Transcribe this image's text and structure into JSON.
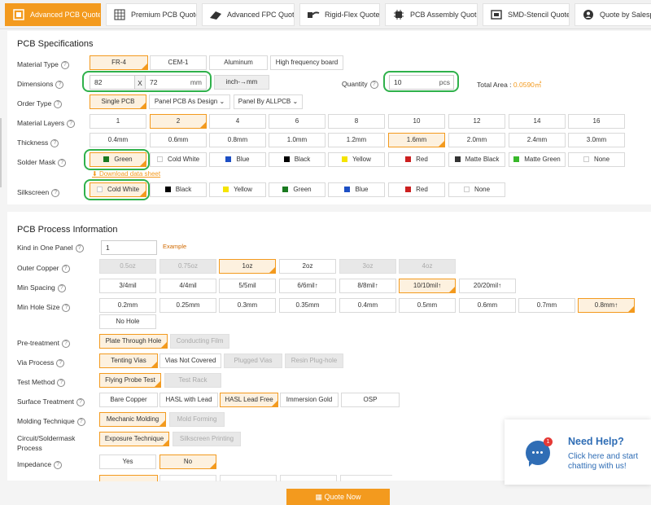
{
  "tabs": [
    "Advanced PCB Quote",
    "Premium PCB Quote",
    "Advanced FPC Quote",
    "Rigid-Flex Quote",
    "PCB Assembly Quote",
    "SMD-Stencil Quote",
    "Quote by Salesperson"
  ],
  "spec": {
    "title": "PCB Specifications",
    "material_type": {
      "label": "Material Type",
      "options": [
        "FR-4",
        "CEM-1",
        "Aluminum",
        "High frequency board"
      ]
    },
    "dimensions": {
      "label": "Dimensions",
      "width": "82",
      "x": "X",
      "height": "72",
      "unit": "mm",
      "convert": "inch-→mm"
    },
    "quantity": {
      "label": "Quantity",
      "value": "10",
      "unit": "pcs"
    },
    "total_area": {
      "label": "Total Area :",
      "value": "0.0590㎡"
    },
    "order_type": {
      "label": "Order Type",
      "options": [
        "Single PCB",
        "Panel PCB As Design",
        "Panel By ALLPCB"
      ]
    },
    "layers": {
      "label": "Material Layers",
      "options": [
        "1",
        "2",
        "4",
        "6",
        "8",
        "10",
        "12",
        "14",
        "16"
      ]
    },
    "thickness": {
      "label": "Thickness",
      "options": [
        "0.4mm",
        "0.6mm",
        "0.8mm",
        "1.0mm",
        "1.2mm",
        "1.6mm",
        "2.0mm",
        "2.4mm",
        "3.0mm"
      ]
    },
    "solder_mask": {
      "label": "Solder Mask",
      "options": [
        "Green",
        "Cold White",
        "Blue",
        "Black",
        "Yellow",
        "Red",
        "Matte Black",
        "Matte Green",
        "None"
      ],
      "download": "Download data sheet"
    },
    "silkscreen": {
      "label": "Silkscreen",
      "options": [
        "Cold White",
        "Black",
        "Yellow",
        "Green",
        "Blue",
        "Red",
        "None"
      ]
    }
  },
  "process": {
    "title": "PCB Process Information",
    "kind": {
      "label": "Kind in One Panel",
      "value": "1",
      "example": "Example"
    },
    "outer_copper": {
      "label": "Outer Copper",
      "options": [
        "0.5oz",
        "0.75oz",
        "1oz",
        "2oz",
        "3oz",
        "4oz"
      ]
    },
    "min_spacing": {
      "label": "Min Spacing",
      "options": [
        "3/4mil",
        "4/4mil",
        "5/5mil",
        "6/6mil↑",
        "8/8mil↑",
        "10/10mil↑",
        "20/20mil↑"
      ]
    },
    "min_hole": {
      "label": "Min Hole Size",
      "options": [
        "0.2mm",
        "0.25mm",
        "0.3mm",
        "0.35mm",
        "0.4mm",
        "0.5mm",
        "0.6mm",
        "0.7mm",
        "0.8mm↑",
        "No Hole"
      ]
    },
    "pretreat": {
      "label": "Pre-treatment",
      "options": [
        "Plate Through Hole",
        "Conducting Film"
      ]
    },
    "via": {
      "label": "Via Process",
      "options": [
        "Tenting Vias",
        "Vias Not Covered",
        "Plugged Vias",
        "Resin Plug-hole"
      ]
    },
    "test": {
      "label": "Test Method",
      "options": [
        "Flying Probe Test",
        "Test Rack"
      ]
    },
    "surface": {
      "label": "Surface Treatment",
      "options": [
        "Bare Copper",
        "HASL with Lead",
        "HASL Lead Free",
        "Immersion Gold",
        "OSP"
      ]
    },
    "molding": {
      "label": "Molding Technique",
      "options": [
        "Mechanic Molding",
        "Mold Forming"
      ]
    },
    "circuit": {
      "label_1": "Circuit/Soldermask",
      "label_2": "Process",
      "options": [
        "Exposure Technique",
        "Silkscreen Printing"
      ]
    },
    "impedance": {
      "label": "Impedance",
      "options": [
        "Yes",
        "No"
      ]
    }
  },
  "quote_button": "Quote Now",
  "help": {
    "title": "Need Help?",
    "text_1": "Click here and start",
    "text_2": "chatting with us!",
    "badge": "1"
  },
  "colors": {
    "accent": "#f39a1e",
    "highlight": "#2fb14b",
    "chat": "#2f6db5"
  }
}
